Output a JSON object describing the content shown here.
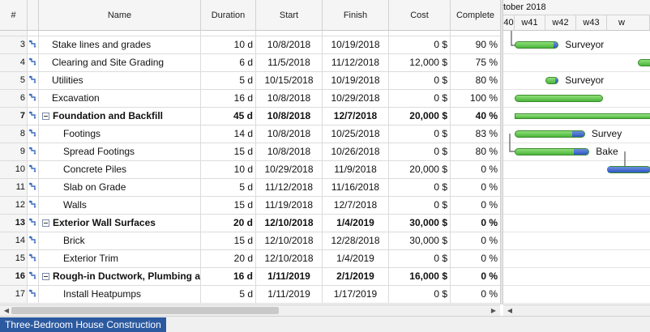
{
  "headers": {
    "num": "#",
    "name": "Name",
    "duration": "Duration",
    "start": "Start",
    "finish": "Finish",
    "cost": "Cost",
    "complete": "Complete"
  },
  "rows": [
    {
      "num": "3",
      "name": "Stake lines and grades",
      "duration": "10 d",
      "start": "10/8/2018",
      "finish": "10/19/2018",
      "cost": "0 $",
      "complete": "90 %",
      "level": 1,
      "summary": false
    },
    {
      "num": "4",
      "name": "Clearing and Site Grading",
      "duration": "6 d",
      "start": "11/5/2018",
      "finish": "11/12/2018",
      "cost": "12,000 $",
      "complete": "75 %",
      "level": 1,
      "summary": false
    },
    {
      "num": "5",
      "name": "Utilities",
      "duration": "5 d",
      "start": "10/15/2018",
      "finish": "10/19/2018",
      "cost": "0 $",
      "complete": "80 %",
      "level": 1,
      "summary": false
    },
    {
      "num": "6",
      "name": "Excavation",
      "duration": "16 d",
      "start": "10/8/2018",
      "finish": "10/29/2018",
      "cost": "0 $",
      "complete": "100 %",
      "level": 1,
      "summary": false
    },
    {
      "num": "7",
      "name": "Foundation and Backfill",
      "duration": "45 d",
      "start": "10/8/2018",
      "finish": "12/7/2018",
      "cost": "20,000 $",
      "complete": "40 %",
      "level": 0,
      "summary": true
    },
    {
      "num": "8",
      "name": "Footings",
      "duration": "14 d",
      "start": "10/8/2018",
      "finish": "10/25/2018",
      "cost": "0 $",
      "complete": "83 %",
      "level": 2,
      "summary": false
    },
    {
      "num": "9",
      "name": "Spread Footings",
      "duration": "15 d",
      "start": "10/8/2018",
      "finish": "10/26/2018",
      "cost": "0 $",
      "complete": "80 %",
      "level": 2,
      "summary": false
    },
    {
      "num": "10",
      "name": "Concrete Piles",
      "duration": "10 d",
      "start": "10/29/2018",
      "finish": "11/9/2018",
      "cost": "20,000 $",
      "complete": "0 %",
      "level": 2,
      "summary": false
    },
    {
      "num": "11",
      "name": "Slab on Grade",
      "duration": "5 d",
      "start": "11/12/2018",
      "finish": "11/16/2018",
      "cost": "0 $",
      "complete": "0 %",
      "level": 2,
      "summary": false
    },
    {
      "num": "12",
      "name": "Walls",
      "duration": "15 d",
      "start": "11/19/2018",
      "finish": "12/7/2018",
      "cost": "0 $",
      "complete": "0 %",
      "level": 2,
      "summary": false
    },
    {
      "num": "13",
      "name": "Exterior Wall Surfaces",
      "duration": "20 d",
      "start": "12/10/2018",
      "finish": "1/4/2019",
      "cost": "30,000 $",
      "complete": "0 %",
      "level": 0,
      "summary": true
    },
    {
      "num": "14",
      "name": "Brick",
      "duration": "15 d",
      "start": "12/10/2018",
      "finish": "12/28/2018",
      "cost": "30,000 $",
      "complete": "0 %",
      "level": 2,
      "summary": false
    },
    {
      "num": "15",
      "name": "Exterior Trim",
      "duration": "20 d",
      "start": "12/10/2018",
      "finish": "1/4/2019",
      "cost": "0 $",
      "complete": "0 %",
      "level": 2,
      "summary": false
    },
    {
      "num": "16",
      "name": "Rough-in Ductwork, Plumbing and",
      "duration": "16 d",
      "start": "1/11/2019",
      "finish": "2/1/2019",
      "cost": "16,000 $",
      "complete": "0 %",
      "level": 0,
      "summary": true
    },
    {
      "num": "17",
      "name": "Install Heatpumps",
      "duration": "5 d",
      "start": "1/11/2019",
      "finish": "1/17/2019",
      "cost": "0 $",
      "complete": "0 %",
      "level": 2,
      "summary": false
    }
  ],
  "gantt": {
    "month_label": "tober 2018",
    "weeks": [
      "40",
      "w41",
      "w42",
      "w43",
      "w"
    ],
    "bar_labels": {
      "row3": "Surveyor",
      "row5": "Surveyor",
      "row8": "Survey",
      "row9": "Bake"
    }
  },
  "sheet_tab": "Three-Bedroom House Construction",
  "colors": {
    "bar_green": "#4cb43a",
    "bar_blue": "#2f57c0",
    "tab_blue": "#2c5aa0"
  }
}
